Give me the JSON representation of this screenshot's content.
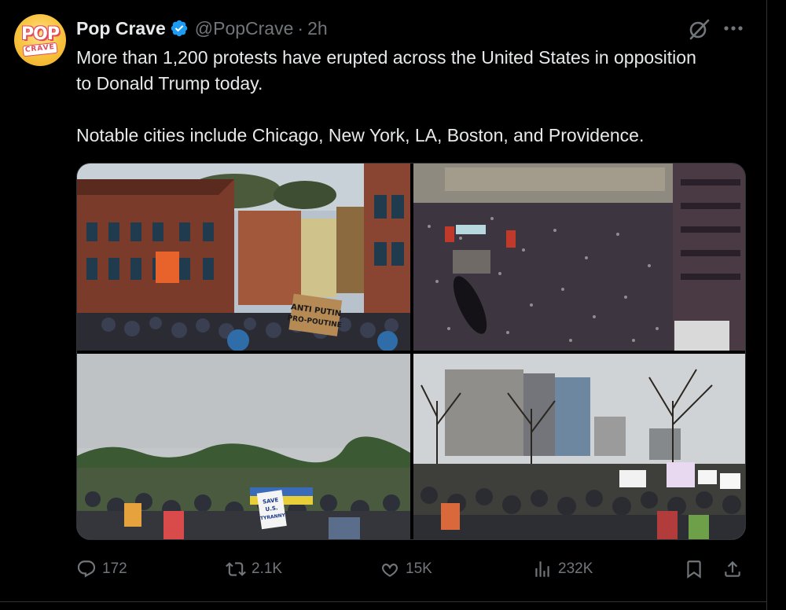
{
  "post": {
    "author": {
      "display_name": "Pop Crave",
      "handle": "@PopCrave",
      "separator": "·",
      "time": "2h",
      "verified": true,
      "avatar_text_top": "POP",
      "avatar_text_bottom": "CRAVE"
    },
    "text": {
      "paragraph1": "More than 1,200 protests have erupted across the United States in opposition to Donald Trump today.",
      "paragraph2": "Notable cities include Chicago, New York, LA, Boston, and Providence."
    },
    "media": {
      "photos": [
        {
          "sign_text": "ANTI PUTIN PRO-POUTINE"
        },
        {
          "sign_text": ""
        },
        {
          "sign_text": "SAVE U.S. FROM TYRANNY"
        },
        {
          "sign_text": ""
        }
      ]
    },
    "metrics": {
      "replies": "172",
      "reposts": "2.1K",
      "likes": "15K",
      "views": "232K"
    }
  },
  "colors": {
    "background": "#000000",
    "text_primary": "#e7e9ea",
    "text_secondary": "#71767b",
    "verified_blue": "#1d9bf0",
    "border": "#2f3336"
  },
  "icons": {
    "verified": "verified-badge-icon",
    "grok": "grok-icon",
    "more": "more-icon",
    "reply": "reply-icon",
    "repost": "repost-icon",
    "like": "like-icon",
    "views": "views-icon",
    "bookmark": "bookmark-icon",
    "share": "share-icon"
  }
}
